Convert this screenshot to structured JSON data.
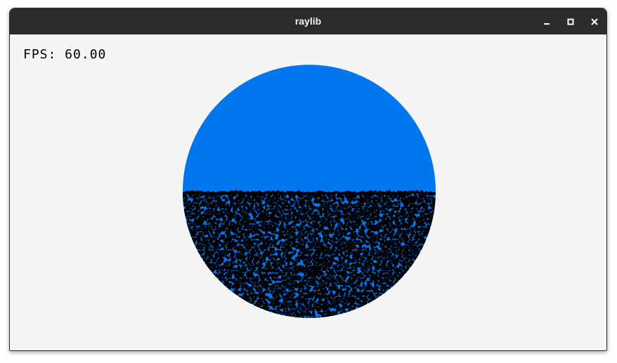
{
  "window": {
    "title": "raylib"
  },
  "titlebar": {
    "controls": [
      {
        "name": "minimize",
        "icon": "minimize-icon"
      },
      {
        "name": "maximize",
        "icon": "maximize-icon"
      },
      {
        "name": "close",
        "icon": "close-icon"
      }
    ]
  },
  "hud": {
    "fps_text": "FPS: 60.00"
  },
  "scene": {
    "container_color": "#0077ee",
    "particle_color": "#000000",
    "fill_fraction": 0.49
  }
}
